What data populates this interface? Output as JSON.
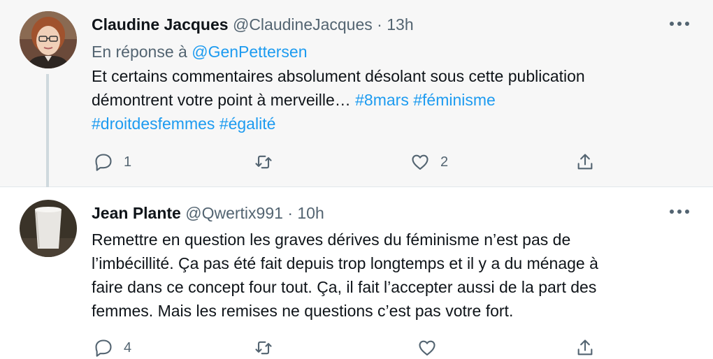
{
  "tweets": [
    {
      "author_name": "Claudine Jacques",
      "handle": "@ClaudineJacques",
      "separator": "·",
      "time": "13h",
      "reply_prefix": "En réponse à",
      "reply_to": "@GenPettersen",
      "text_line1": "Et certains commentaires absolument désolant sous cette publication",
      "text_line2_plain": "démontrent votre point à merveille… ",
      "hashtag_1": "#8mars",
      "hashtag_2": "#féminisme",
      "hashtag_3": "#droitdesfemmes",
      "hashtag_4": "#égalité",
      "reply_count": "1",
      "retweet_count": "",
      "like_count": "2",
      "more_icon": "more-horizontal-icon",
      "avatar_icon": "avatar-woman-glasses"
    },
    {
      "author_name": "Jean Plante",
      "handle": "@Qwertix991",
      "separator": "·",
      "time": "10h",
      "text_lines": [
        "Remettre en question les graves dérives du féminisme n’est pas de",
        "l’imbécillité. Ça pas été fait depuis trop longtemps et il y a du ménage à",
        "faire dans ce concept four tout. Ça, il fait l’accepter aussi de la part des",
        "femmes. Mais les remises ne questions c’est pas votre fort."
      ],
      "reply_count": "4",
      "retweet_count": "",
      "like_count": "",
      "more_icon": "more-horizontal-icon",
      "avatar_icon": "avatar-white-cup"
    }
  ],
  "colors": {
    "link": "#1d9bf0",
    "secondary_text": "#536471",
    "primary_text": "#0f1419",
    "highlight_bg": "#f7f7f7",
    "thread_line": "#cfd9de"
  }
}
